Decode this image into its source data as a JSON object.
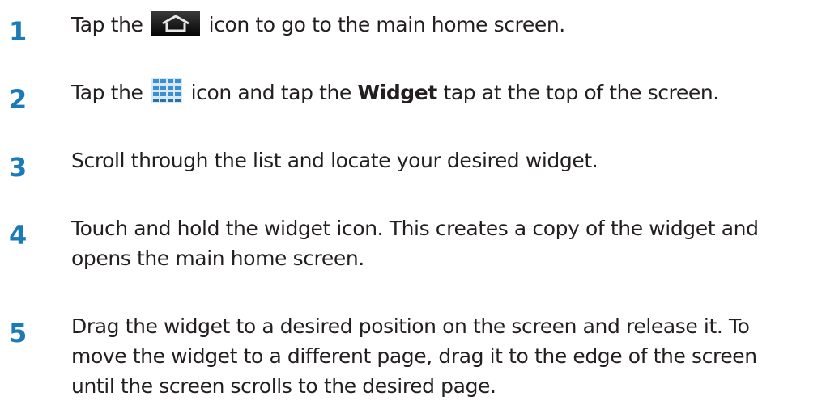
{
  "steps": [
    {
      "number": "1",
      "before_icon": "Tap the",
      "icon": "home-icon",
      "after_icon": "icon to go to the main home screen."
    },
    {
      "number": "2",
      "before_icon": "Tap the",
      "icon": "apps-grid-icon",
      "after_icon": "icon and tap the",
      "bold": "Widget",
      "after_bold": "tap at the top of the screen."
    },
    {
      "number": "3",
      "line1": "Scroll through the list and locate your desired widget."
    },
    {
      "number": "4",
      "line1": "Touch and hold the widget icon. This creates a copy of the widget and",
      "line2": "opens the main home screen."
    },
    {
      "number": "5",
      "line1": "Drag the widget to a desired position on the screen and release it. To",
      "line2": "move the widget to a different page, drag it to the edge of the screen",
      "line3": "until the screen scrolls to the desired page."
    }
  ],
  "colors": {
    "step_number": "#1b7bb8",
    "text": "#231f20",
    "home_icon_bg": "#1a1a1a",
    "apps_icon_blue": "#3a8fd0"
  }
}
